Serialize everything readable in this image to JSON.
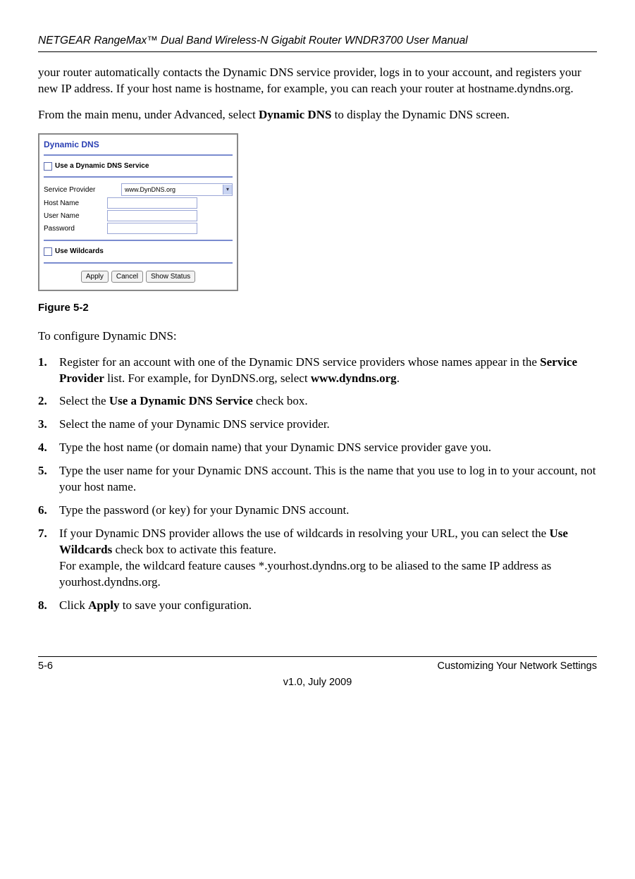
{
  "header": {
    "title": "NETGEAR RangeMax™ Dual Band Wireless-N Gigabit Router WNDR3700 User Manual"
  },
  "intro": {
    "p1": "your router automatically contacts the Dynamic DNS service provider, logs in to your account, and registers your new IP address. If your host name is hostname, for example, you can reach your router at hostname.dyndns.org.",
    "p2_before": "From the main menu, under Advanced, select ",
    "p2_bold": "Dynamic DNS",
    "p2_after": " to display the Dynamic DNS screen."
  },
  "figure": {
    "panel_title": "Dynamic DNS",
    "use_service_label": "Use a Dynamic DNS Service",
    "service_provider_label": "Service Provider",
    "service_provider_value": "www.DynDNS.org",
    "host_name_label": "Host Name",
    "user_name_label": "User Name",
    "password_label": "Password",
    "use_wildcards_label": "Use Wildcards",
    "apply_button": "Apply",
    "cancel_button": "Cancel",
    "show_status_button": "Show Status",
    "caption": "Figure 5-2"
  },
  "configure_heading": "To configure Dynamic DNS:",
  "steps": {
    "s1a": "Register for an account with one of the Dynamic DNS service providers whose names appear in the ",
    "s1b": "Service Provider",
    "s1c": " list. For example, for DynDNS.org, select ",
    "s1d": "www.dyndns.org",
    "s1e": ".",
    "s2a": "Select the ",
    "s2b": "Use a Dynamic DNS Service",
    "s2c": " check box.",
    "s3": "Select the name of your Dynamic DNS service provider.",
    "s4": "Type the host name (or domain name) that your Dynamic DNS service provider gave you.",
    "s5": "Type the user name for your Dynamic DNS account. This is the name that you use to log in to your account, not your host name.",
    "s6": "Type the password (or key) for your Dynamic DNS account.",
    "s7a": "If your Dynamic DNS provider allows the use of wildcards in resolving your URL, you can select the ",
    "s7b": "Use Wildcards",
    "s7c": " check box to activate this feature.",
    "s7d": "For example, the wildcard feature causes *.yourhost.dyndns.org to be aliased to the same IP address as yourhost.dyndns.org.",
    "s8a": "Click ",
    "s8b": "Apply",
    "s8c": " to save your configuration."
  },
  "footer": {
    "page": "5-6",
    "section": "Customizing Your Network Settings",
    "version": "v1.0, July 2009"
  }
}
